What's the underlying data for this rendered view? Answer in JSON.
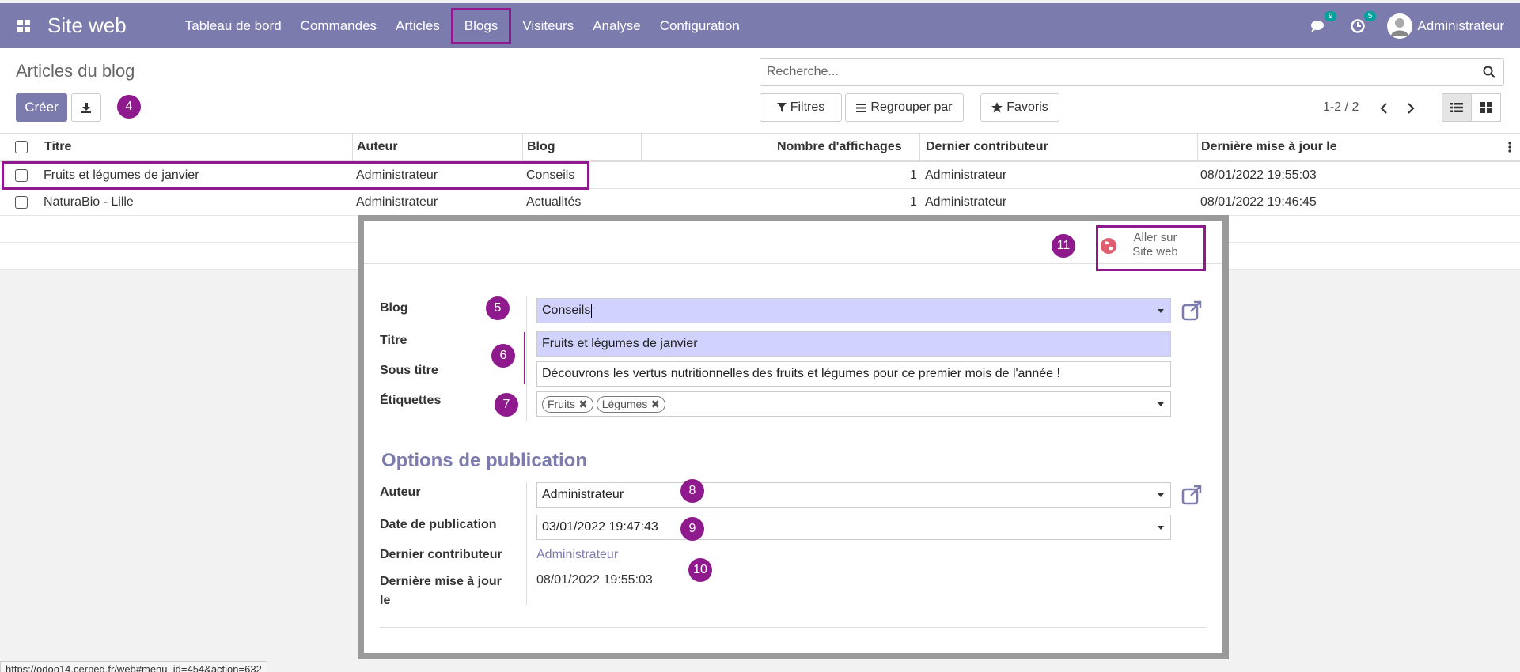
{
  "navbar": {
    "brand": "Site web",
    "menu": [
      "Tableau de bord",
      "Commandes",
      "Articles",
      "Blogs",
      "Visiteurs",
      "Analyse",
      "Configuration"
    ],
    "messages_count": "9",
    "activities_count": "5",
    "user": "Administrateur"
  },
  "control": {
    "breadcrumb": "Articles du blog",
    "create_label": "Créer",
    "search_placeholder": "Recherche...",
    "filters_label": "Filtres",
    "groupby_label": "Regrouper par",
    "favorites_label": "Favoris",
    "pager": "1-2 / 2"
  },
  "markers": {
    "m4": "4",
    "m5": "5",
    "m6": "6",
    "m7": "7",
    "m8": "8",
    "m9": "9",
    "m10": "10",
    "m11": "11"
  },
  "table": {
    "headers": {
      "title": "Titre",
      "author": "Auteur",
      "blog": "Blog",
      "views": "Nombre d'affichages",
      "last_contributor": "Dernier contributeur",
      "last_update": "Dernière mise à jour le"
    },
    "rows": [
      {
        "title": "Fruits et légumes de janvier",
        "author": "Administrateur",
        "blog": "Conseils",
        "views": "1",
        "last_contributor": "Administrateur",
        "last_update": "08/01/2022 19:55:03"
      },
      {
        "title": "NaturaBio - Lille",
        "author": "Administrateur",
        "blog": "Actualités",
        "views": "1",
        "last_contributor": "Administrateur",
        "last_update": "08/01/2022 19:46:45"
      }
    ]
  },
  "form": {
    "smart_button": {
      "line1": "Aller sur",
      "line2": "Site web"
    },
    "labels": {
      "blog": "Blog",
      "title": "Titre",
      "subtitle": "Sous titre",
      "tags": "Étiquettes",
      "author": "Auteur",
      "publish_date": "Date de publication",
      "last_contributor": "Dernier contributeur",
      "last_update_1": "Dernière mise à jour",
      "last_update_2": "le"
    },
    "values": {
      "blog": "Conseils",
      "title": "Fruits et légumes de janvier",
      "subtitle": "Découvrons les vertus nutritionnelles des fruits et légumes pour ce premier mois de l'année !",
      "tags": [
        "Fruits",
        "Légumes"
      ],
      "author": "Administrateur",
      "publish_date": "03/01/2022 19:47:43",
      "last_contributor": "Administrateur",
      "last_update": "08/01/2022 19:55:03"
    },
    "section_title": "Options de publication"
  },
  "statusbar": "https://odoo14.cerpeg.fr/web#menu_id=454&action=632",
  "colors": {
    "primary": "#7c7bad",
    "marker": "#8e1a8e",
    "required_field": "#d2d2ff"
  }
}
